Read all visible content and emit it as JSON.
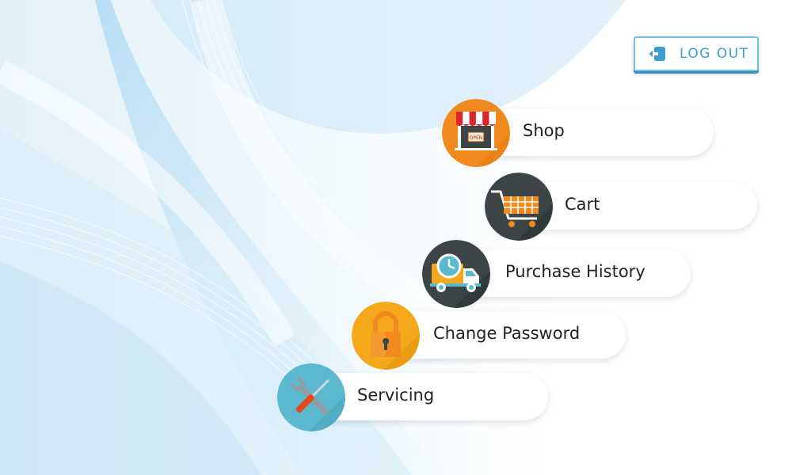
{
  "header": {
    "logout_label": "LOG OUT"
  },
  "menu": {
    "items": [
      {
        "label": "Shop",
        "icon": "shop-icon",
        "color": "#f08a1e"
      },
      {
        "label": "Cart",
        "icon": "cart-icon",
        "color": "#3d4446"
      },
      {
        "label": "Purchase History",
        "icon": "delivery-truck-icon",
        "color": "#3d4446"
      },
      {
        "label": "Change Password",
        "icon": "padlock-icon",
        "color": "#f5a81a"
      },
      {
        "label": "Servicing",
        "icon": "wrench-screwdriver-icon",
        "color": "#5ab8cf"
      }
    ]
  },
  "colors": {
    "accent": "#3c9dd0",
    "background_tint": "#cfe8f7"
  }
}
